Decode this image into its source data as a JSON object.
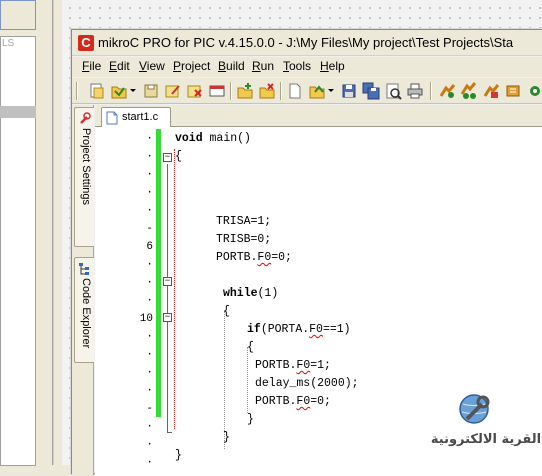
{
  "background_app": {
    "label": "LS"
  },
  "window": {
    "app_icon_letter": "C",
    "title": "mikroC PRO for PIC v.4.15.0.0 - J:\\My Files\\My project\\Test Projects\\Sta"
  },
  "menu": [
    {
      "label": "File",
      "ul": "F",
      "rest": "ile"
    },
    {
      "label": "Edit",
      "ul": "E",
      "rest": "dit"
    },
    {
      "label": "View",
      "ul": "V",
      "rest": "iew"
    },
    {
      "label": "Project",
      "ul": "P",
      "rest": "roject"
    },
    {
      "label": "Build",
      "ul": "B",
      "rest": "uild"
    },
    {
      "label": "Run",
      "ul": "R",
      "rest": "un"
    },
    {
      "label": "Tools",
      "ul": "T",
      "rest": "ools"
    },
    {
      "label": "Help",
      "ul": "H",
      "rest": "elp"
    }
  ],
  "side_tabs": {
    "project_settings": "Project Settings",
    "code_explorer": "Code Explorer"
  },
  "editor_tab": {
    "label": "start1.c"
  },
  "gutter": [
    "·",
    "·",
    "·",
    "·",
    "·",
    "-",
    "6",
    "·",
    "·",
    "·",
    "10",
    "·",
    "·",
    "·",
    "·",
    "-",
    "·",
    "·",
    "·"
  ],
  "code": {
    "l1_kw": "void",
    "l1_rest": " main()",
    "l2": "{",
    "l5": "TRISA=1;",
    "l6": "TRISB=0;",
    "l7_a": "PORTB.",
    "l7_sq": "F0",
    "l7_b": "=0;",
    "l9_kw": "while",
    "l9_rest": "(1)",
    "l10": "{",
    "l11_kw": "if",
    "l11_a": "(PORTA.",
    "l11_sq": "F0",
    "l11_b": "==1)",
    "l12": "{",
    "l13_a": "PORTB.",
    "l13_sq": "F0",
    "l13_b": "=1;",
    "l14": "delay_ms(2000);",
    "l15_a": "PORTB.",
    "l15_sq": "F0",
    "l15_b": "=0;",
    "l16": "}",
    "l17": "}",
    "l18": "}"
  },
  "watermark": {
    "text": "القرية الالكترونية"
  }
}
